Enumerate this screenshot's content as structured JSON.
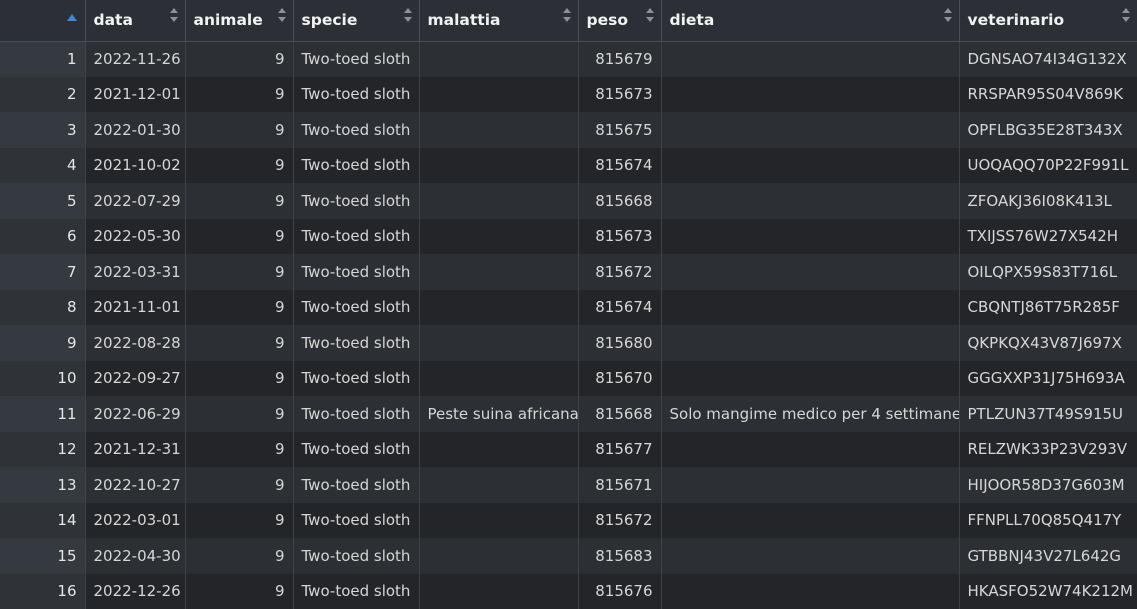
{
  "colors": {
    "sort_active": "#3d8bd8",
    "sort_inactive": "#8a9097"
  },
  "columns": [
    {
      "key": "data",
      "label": "data"
    },
    {
      "key": "animale",
      "label": "animale"
    },
    {
      "key": "specie",
      "label": "specie"
    },
    {
      "key": "malattia",
      "label": "malattia"
    },
    {
      "key": "peso",
      "label": "peso"
    },
    {
      "key": "dieta",
      "label": "dieta"
    },
    {
      "key": "veterinario",
      "label": "veterinario"
    }
  ],
  "rows": [
    {
      "idx": "1",
      "data": "2022-11-26",
      "animale": "9",
      "specie": "Two-toed sloth",
      "malattia": "",
      "peso": "815679",
      "dieta": "",
      "veterinario": "DGNSAO74I34G132X"
    },
    {
      "idx": "2",
      "data": "2021-12-01",
      "animale": "9",
      "specie": "Two-toed sloth",
      "malattia": "",
      "peso": "815673",
      "dieta": "",
      "veterinario": "RRSPAR95S04V869K"
    },
    {
      "idx": "3",
      "data": "2022-01-30",
      "animale": "9",
      "specie": "Two-toed sloth",
      "malattia": "",
      "peso": "815675",
      "dieta": "",
      "veterinario": "OPFLBG35E28T343X"
    },
    {
      "idx": "4",
      "data": "2021-10-02",
      "animale": "9",
      "specie": "Two-toed sloth",
      "malattia": "",
      "peso": "815674",
      "dieta": "",
      "veterinario": "UOQAQQ70P22F991L"
    },
    {
      "idx": "5",
      "data": "2022-07-29",
      "animale": "9",
      "specie": "Two-toed sloth",
      "malattia": "",
      "peso": "815668",
      "dieta": "",
      "veterinario": "ZFOAKJ36I08K413L"
    },
    {
      "idx": "6",
      "data": "2022-05-30",
      "animale": "9",
      "specie": "Two-toed sloth",
      "malattia": "",
      "peso": "815673",
      "dieta": "",
      "veterinario": "TXIJSS76W27X542H"
    },
    {
      "idx": "7",
      "data": "2022-03-31",
      "animale": "9",
      "specie": "Two-toed sloth",
      "malattia": "",
      "peso": "815672",
      "dieta": "",
      "veterinario": "OILQPX59S83T716L"
    },
    {
      "idx": "8",
      "data": "2021-11-01",
      "animale": "9",
      "specie": "Two-toed sloth",
      "malattia": "",
      "peso": "815674",
      "dieta": "",
      "veterinario": "CBQNTJ86T75R285F"
    },
    {
      "idx": "9",
      "data": "2022-08-28",
      "animale": "9",
      "specie": "Two-toed sloth",
      "malattia": "",
      "peso": "815680",
      "dieta": "",
      "veterinario": "QKPKQX43V87J697X"
    },
    {
      "idx": "10",
      "data": "2022-09-27",
      "animale": "9",
      "specie": "Two-toed sloth",
      "malattia": "",
      "peso": "815670",
      "dieta": "",
      "veterinario": "GGGXXP31J75H693A"
    },
    {
      "idx": "11",
      "data": "2022-06-29",
      "animale": "9",
      "specie": "Two-toed sloth",
      "malattia": "Peste suina africana",
      "peso": "815668",
      "dieta": "Solo mangime medico per 4 settimane",
      "veterinario": "PTLZUN37T49S915U"
    },
    {
      "idx": "12",
      "data": "2021-12-31",
      "animale": "9",
      "specie": "Two-toed sloth",
      "malattia": "",
      "peso": "815677",
      "dieta": "",
      "veterinario": "RELZWK33P23V293V"
    },
    {
      "idx": "13",
      "data": "2022-10-27",
      "animale": "9",
      "specie": "Two-toed sloth",
      "malattia": "",
      "peso": "815671",
      "dieta": "",
      "veterinario": "HIJOOR58D37G603M"
    },
    {
      "idx": "14",
      "data": "2022-03-01",
      "animale": "9",
      "specie": "Two-toed sloth",
      "malattia": "",
      "peso": "815672",
      "dieta": "",
      "veterinario": "FFNPLL70Q85Q417Y"
    },
    {
      "idx": "15",
      "data": "2022-04-30",
      "animale": "9",
      "specie": "Two-toed sloth",
      "malattia": "",
      "peso": "815683",
      "dieta": "",
      "veterinario": "GTBBNJ43V27L642G"
    },
    {
      "idx": "16",
      "data": "2022-12-26",
      "animale": "9",
      "specie": "Two-toed sloth",
      "malattia": "",
      "peso": "815676",
      "dieta": "",
      "veterinario": "HKASFO52W74K212M"
    }
  ]
}
